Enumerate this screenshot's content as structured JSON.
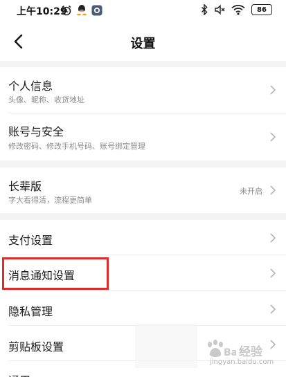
{
  "status_bar": {
    "time": "上午10:29",
    "battery": "86",
    "icons_left": [
      "alarm-icon",
      "qq-icon",
      "app-notification-icon"
    ],
    "icons_right": [
      "bluetooth-icon",
      "mute-icon",
      "wifi-icon",
      "battery-icon"
    ]
  },
  "nav": {
    "title": "设置",
    "back_icon": "chevron-left-icon"
  },
  "groups": [
    {
      "items": [
        {
          "title": "个人信息",
          "subtitle": "头像、昵称、收货地址"
        },
        {
          "title": "账号与安全",
          "subtitle": "修改密码、修改手机号码、账号绑定管理"
        }
      ]
    },
    {
      "items": [
        {
          "title": "长辈版",
          "subtitle": "字大看得清，流程更简单",
          "value": "未开启"
        }
      ]
    },
    {
      "items": [
        {
          "title": "支付设置"
        },
        {
          "title": "消息通知设置",
          "highlighted": true
        },
        {
          "title": "隐私管理"
        },
        {
          "title": "剪贴板设置"
        },
        {
          "title": "通用"
        }
      ]
    }
  ],
  "watermark": {
    "text": "经验",
    "url": "jingyan.baidu.com"
  },
  "colors": {
    "background": "#f3f3f3",
    "highlight": "#e02a2a",
    "secondary_text": "#8a8a8a"
  }
}
